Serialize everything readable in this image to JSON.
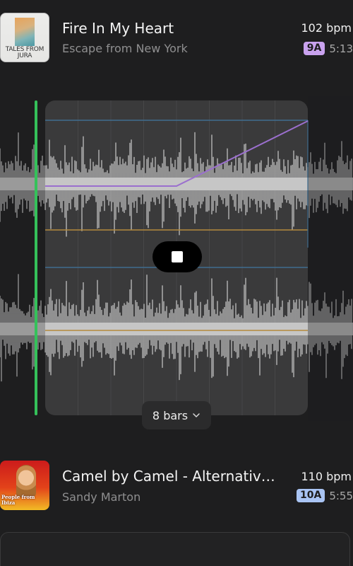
{
  "tracks": [
    {
      "title": "Fire In My Heart",
      "artist": "Escape from New York",
      "bpm": "102 bpm",
      "key": "9A",
      "duration": "5:13",
      "artwork_text": "TALES FROM JURA"
    },
    {
      "title": "Camel by Camel - Alternative...",
      "artist": "Sandy Marton",
      "bpm": "110 bpm",
      "key": "10A",
      "duration": "5:55",
      "artwork_text": "People from Ibiza"
    }
  ],
  "player": {
    "loop_length_label": "8 bars",
    "stop_icon": "stop-icon",
    "dropdown_icon": "chevron-down-icon"
  },
  "colors": {
    "background": "#1e1e1f",
    "playhead": "#35c15a",
    "key_9A": "#c9a2ee",
    "key_10A": "#a9c4f3",
    "envelope_line": "#9b6fce",
    "band_line_blue": "#3f6d8f",
    "band_line_orange": "#b58a3c"
  }
}
